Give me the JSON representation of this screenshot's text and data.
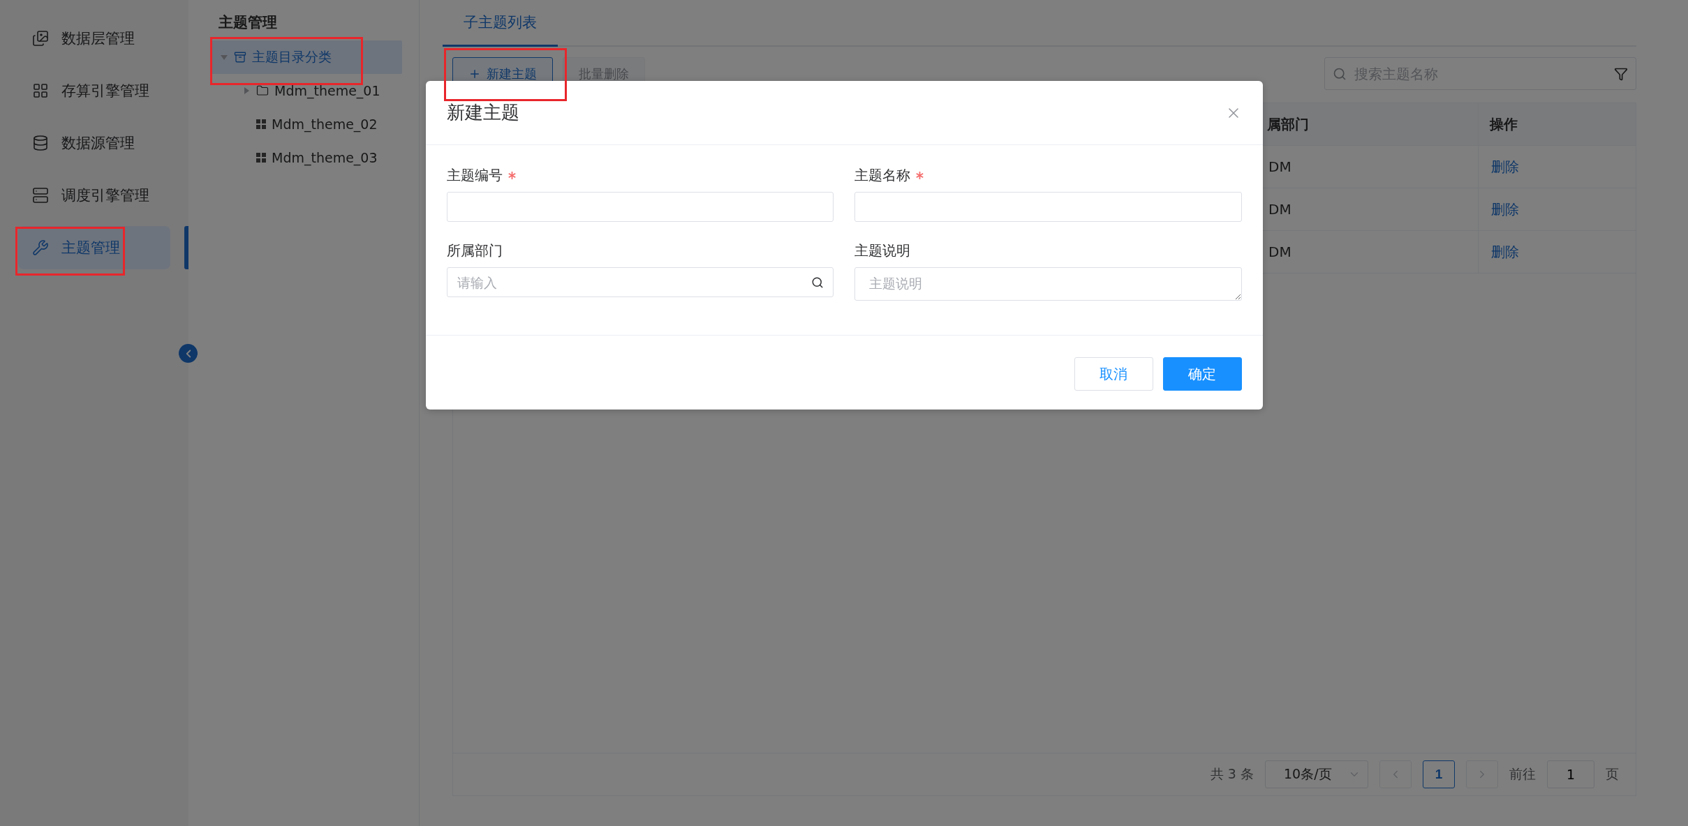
{
  "sidebar": {
    "items": [
      {
        "label": "数据层管理",
        "selected": false,
        "annotated": false
      },
      {
        "label": "存算引擎管理",
        "selected": false,
        "annotated": false
      },
      {
        "label": "数据源管理",
        "selected": false,
        "annotated": false
      },
      {
        "label": "调度引擎管理",
        "selected": false,
        "annotated": false
      },
      {
        "label": "主题管理",
        "selected": true,
        "annotated": true
      }
    ]
  },
  "tree": {
    "title": "主题管理",
    "root": {
      "label": "主题目录分类",
      "expanded": true,
      "selected": true,
      "annotated": true,
      "children": [
        {
          "label": "Mdm_theme_01",
          "kind": "folder",
          "expanded": false
        },
        {
          "label": "Mdm_theme_02",
          "kind": "leaf"
        },
        {
          "label": "Mdm_theme_03",
          "kind": "leaf"
        }
      ]
    }
  },
  "main": {
    "tabs": [
      {
        "label": "子主题列表",
        "selected": true
      }
    ],
    "toolbar": [
      {
        "label": "新建主题",
        "kind": "add",
        "disabled": false,
        "annotated": true
      },
      {
        "label": "批量删除",
        "kind": "plain",
        "disabled": true,
        "annotated": false
      }
    ],
    "search": {
      "placeholder": "搜索主题名称"
    },
    "table": {
      "columns": [
        "属部门",
        "操作"
      ],
      "rows": [
        {
          "department": "DM",
          "action": "删除"
        },
        {
          "department": "DM",
          "action": "删除"
        },
        {
          "department": "DM",
          "action": "删除"
        }
      ]
    },
    "pagination": {
      "total": "共 3 条",
      "page_size": "10条/页",
      "pages": [
        {
          "label": "1",
          "selected": true
        }
      ],
      "goto_label": "前往",
      "goto_value": "1",
      "page_suffix": "页"
    }
  },
  "modal": {
    "title": "新建主题",
    "fields": [
      {
        "label": "主题编号",
        "required": true,
        "kind": "text"
      },
      {
        "label": "主题名称",
        "required": true,
        "kind": "text"
      },
      {
        "label": "所属部门",
        "required": false,
        "kind": "search",
        "placeholder": "请输入"
      },
      {
        "label": "主题说明",
        "required": false,
        "kind": "textarea",
        "placeholder": "主题说明"
      }
    ],
    "buttons": [
      {
        "label": "取消",
        "primary": false
      },
      {
        "label": "确定",
        "primary": true
      }
    ]
  }
}
